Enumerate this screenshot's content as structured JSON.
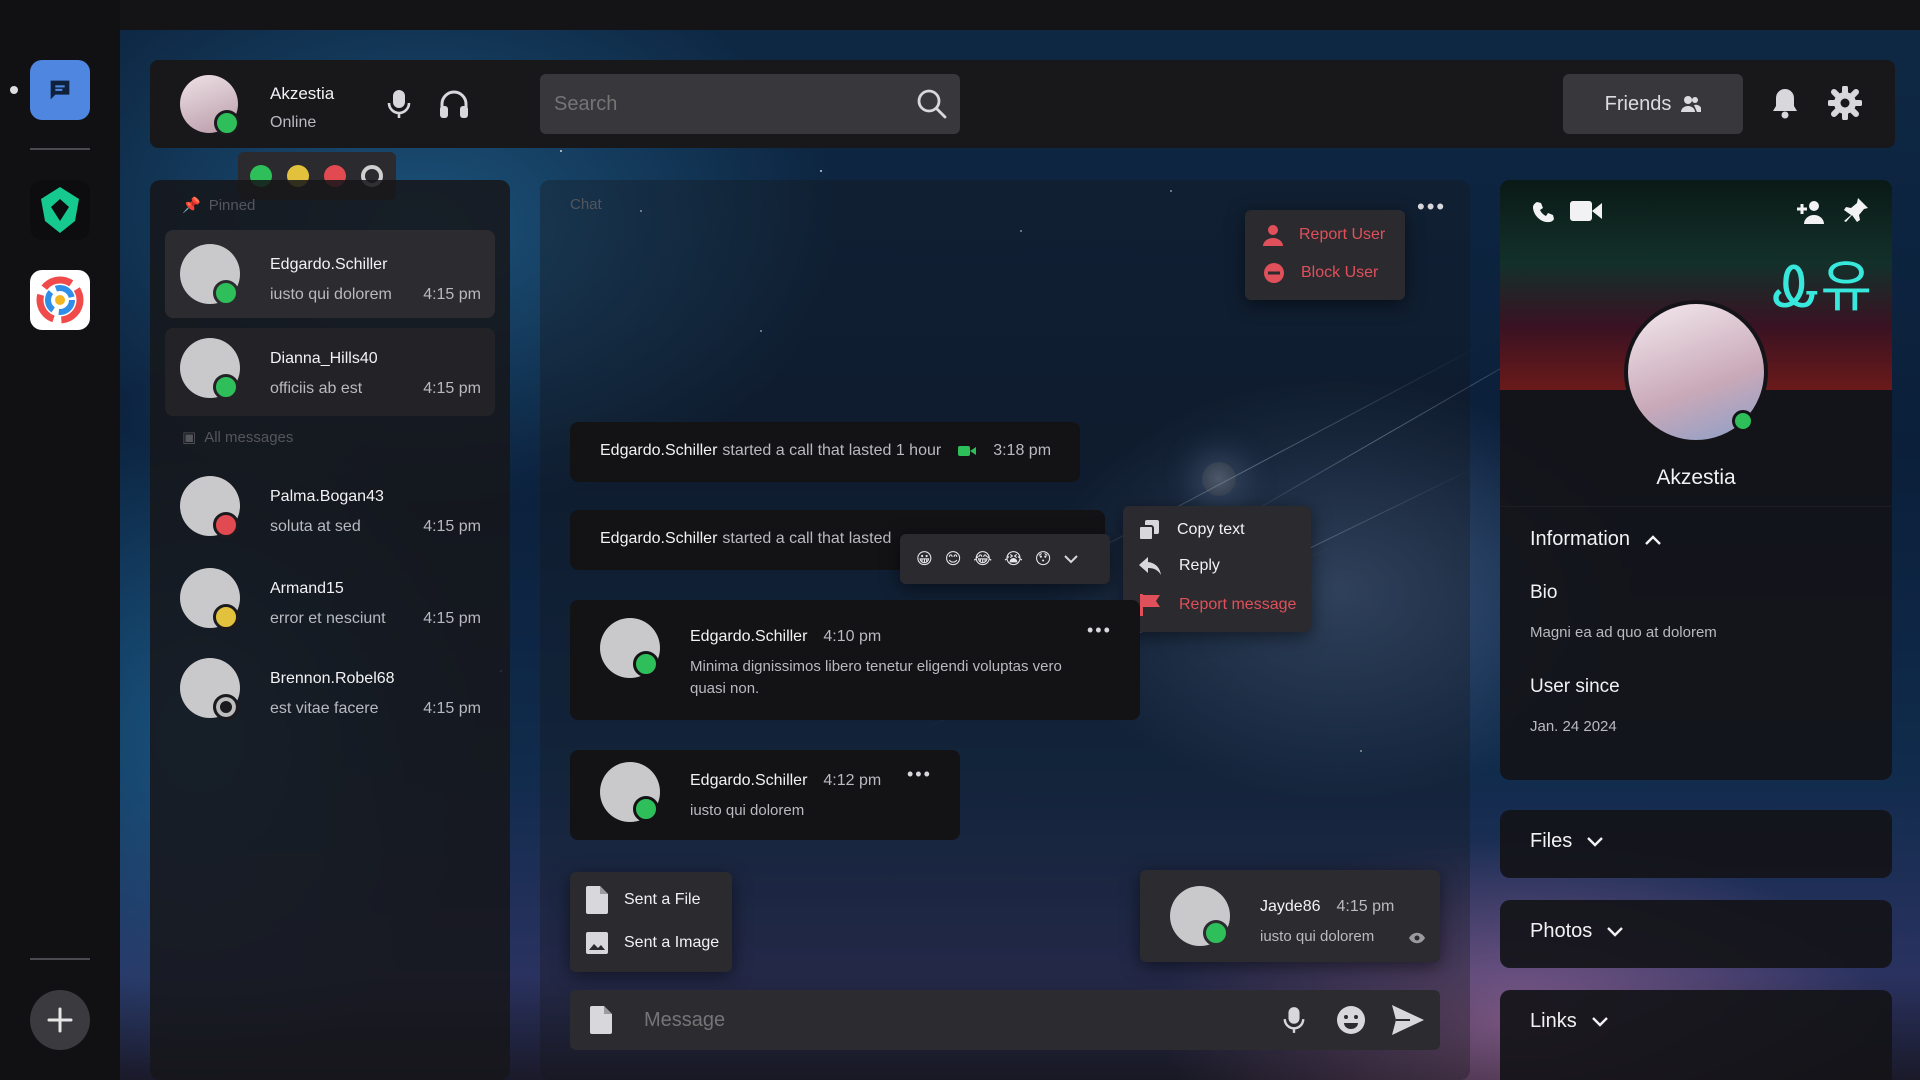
{
  "user": {
    "name": "Akzestia",
    "status": "Online"
  },
  "status_options": [
    "online",
    "idle",
    "busy",
    "offline"
  ],
  "search": {
    "placeholder": "Search"
  },
  "header": {
    "friends_label": "Friends"
  },
  "sidebar": {
    "pinned_label": "Pinned",
    "all_label": "All messages",
    "pinned": [
      {
        "name": "Edgardo.Schiller",
        "preview": "iusto qui dolorem",
        "time": "4:15 pm",
        "status": "green"
      },
      {
        "name": "Dianna_Hills40",
        "preview": "officiis ab est",
        "time": "4:15 pm",
        "status": "green"
      }
    ],
    "all": [
      {
        "name": "Palma.Bogan43",
        "preview": "soluta at sed",
        "time": "4:15 pm",
        "status": "red"
      },
      {
        "name": "Armand15",
        "preview": "error et nesciunt",
        "time": "4:15 pm",
        "status": "yellow"
      },
      {
        "name": "Brennon.Robel68",
        "preview": "est vitae facere",
        "time": "4:15 pm",
        "status": "off"
      }
    ]
  },
  "chat": {
    "label": "Chat",
    "user_menu": [
      "Report User",
      "Block User"
    ],
    "calls": [
      {
        "user": "Edgardo.Schiller",
        "text": "started a call that lasted 1 hour",
        "time": "3:18 pm"
      },
      {
        "user": "Edgardo.Schiller",
        "text": "started a call that lasted"
      }
    ],
    "reactions": [
      "😀",
      "😊",
      "😂",
      "😭",
      "😯"
    ],
    "context_menu": [
      "Copy text",
      "Reply",
      "Report message"
    ],
    "messages": [
      {
        "user": "Edgardo.Schiller",
        "time": "4:10 pm",
        "text": "Minima dignissimos libero tenetur eligendi voluptas vero quasi non."
      },
      {
        "user": "Edgardo.Schiller",
        "time": "4:12 pm",
        "text": "iusto qui dolorem"
      }
    ],
    "attach_menu": [
      "Sent a File",
      "Sent a Image"
    ],
    "own_message": {
      "user": "Jayde86",
      "time": "4:15 pm",
      "text": "iusto qui dolorem"
    },
    "composer_placeholder": "Message"
  },
  "profile": {
    "name": "Akzestia",
    "banner_text": "Ꮂ유",
    "info_title": "Information",
    "bio_label": "Bio",
    "bio_text": "Magni ea ad quo at dolorem",
    "since_label": "User since",
    "since_value": "Jan. 24 2024",
    "files_label": "Files",
    "photos_label": "Photos",
    "links_label": "Links"
  },
  "colors": {
    "accent": "#5b8fe0",
    "online": "#2fbf5a",
    "danger": "#e0505a",
    "idle": "#e2c23c"
  }
}
